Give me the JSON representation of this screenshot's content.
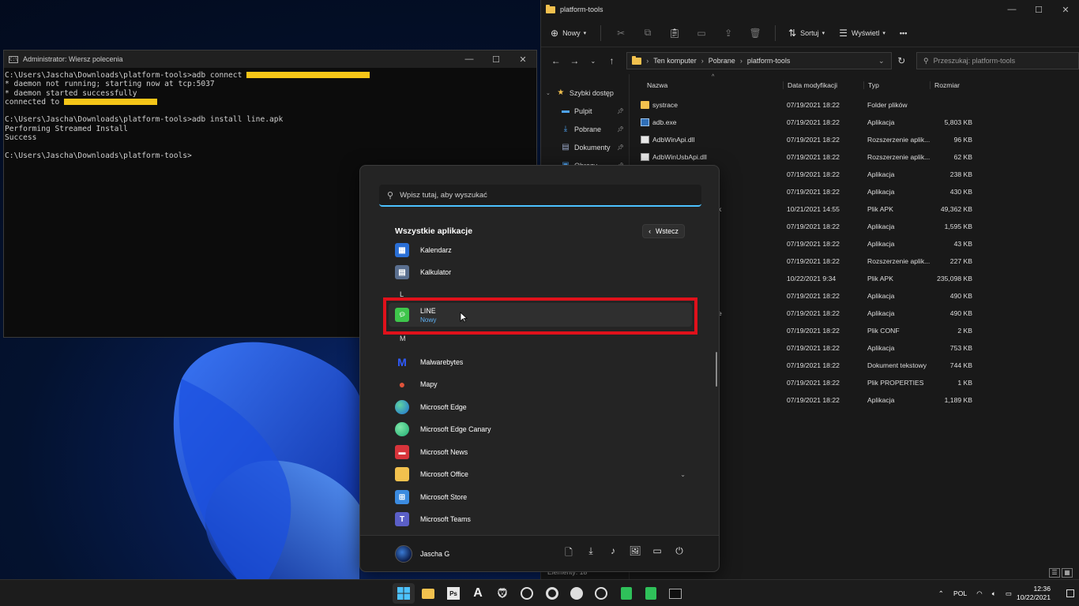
{
  "cmd": {
    "title": "Administrator: Wiersz polecenia",
    "lines": [
      "C:\\Users\\Jascha\\Downloads\\platform-tools>adb connect ",
      "* daemon not running; starting now at tcp:5037",
      "* daemon started successfully",
      "connected to ",
      "",
      "C:\\Users\\Jascha\\Downloads\\platform-tools>adb install line.apk",
      "Performing Streamed Install",
      "Success",
      "",
      "C:\\Users\\Jascha\\Downloads\\platform-tools>"
    ]
  },
  "explorer": {
    "title": "platform-tools",
    "toolbar": {
      "new_label": "Nowy",
      "sort_label": "Sortuj",
      "view_label": "Wyświetl",
      "more": "•••"
    },
    "breadcrumb": [
      "Ten komputer",
      "Pobrane",
      "platform-tools"
    ],
    "search_placeholder": "Przeszukaj: platform-tools",
    "nav": [
      {
        "label": "Szybki dostęp",
        "icon": "star-icon"
      },
      {
        "label": "Pulpit",
        "icon": "desktop-icon"
      },
      {
        "label": "Pobrane",
        "icon": "download-icon"
      },
      {
        "label": "Dokumenty",
        "icon": "document-icon"
      },
      {
        "label": "Obrazy",
        "icon": "picture-icon"
      }
    ],
    "columns": {
      "name": "Nazwa",
      "date": "Data modyfikacji",
      "type": "Typ",
      "size": "Rozmiar"
    },
    "files": [
      {
        "name": "systrace",
        "date": "07/19/2021 18:22",
        "type": "Folder plików",
        "size": "",
        "icon": "folder"
      },
      {
        "name": "adb.exe",
        "date": "07/19/2021 18:22",
        "type": "Aplikacja",
        "size": "5,803 KB",
        "icon": "exe"
      },
      {
        "name": "AdbWinApi.dll",
        "date": "07/19/2021 18:22",
        "type": "Rozszerzenie aplik...",
        "size": "96 KB",
        "icon": "dll"
      },
      {
        "name": "AdbWinUsbApi.dll",
        "date": "07/19/2021 18:22",
        "type": "Rozszerzenie aplik...",
        "size": "62 KB",
        "icon": "dll"
      },
      {
        "name": "",
        "date": "07/19/2021 18:22",
        "type": "Aplikacja",
        "size": "238 KB",
        "icon": ""
      },
      {
        "name": "",
        "date": "07/19/2021 18:22",
        "type": "Aplikacja",
        "size": "430 KB",
        "icon": ""
      },
      {
        "name": "k",
        "date": "10/21/2021 14:55",
        "type": "Plik APK",
        "size": "49,362 KB",
        "icon": ""
      },
      {
        "name": "",
        "date": "07/19/2021 18:22",
        "type": "Aplikacja",
        "size": "1,595 KB",
        "icon": ""
      },
      {
        "name": "",
        "date": "07/19/2021 18:22",
        "type": "Aplikacja",
        "size": "43 KB",
        "icon": ""
      },
      {
        "name": "",
        "date": "07/19/2021 18:22",
        "type": "Rozszerzenie aplik...",
        "size": "227 KB",
        "icon": ""
      },
      {
        "name": "",
        "date": "10/22/2021 9:34",
        "type": "Plik APK",
        "size": "235,098 KB",
        "icon": ""
      },
      {
        "name": "",
        "date": "07/19/2021 18:22",
        "type": "Aplikacja",
        "size": "490 KB",
        "icon": ""
      },
      {
        "name": "e",
        "date": "07/19/2021 18:22",
        "type": "Aplikacja",
        "size": "490 KB",
        "icon": ""
      },
      {
        "name": "",
        "date": "07/19/2021 18:22",
        "type": "Plik CONF",
        "size": "2 KB",
        "icon": ""
      },
      {
        "name": "",
        "date": "07/19/2021 18:22",
        "type": "Aplikacja",
        "size": "753 KB",
        "icon": ""
      },
      {
        "name": "",
        "date": "07/19/2021 18:22",
        "type": "Dokument tekstowy",
        "size": "744 KB",
        "icon": ""
      },
      {
        "name": "",
        "date": "07/19/2021 18:22",
        "type": "Plik PROPERTIES",
        "size": "1 KB",
        "icon": ""
      },
      {
        "name": "",
        "date": "07/19/2021 18:22",
        "type": "Aplikacja",
        "size": "1,189 KB",
        "icon": ""
      }
    ],
    "status": "Elementy: 18"
  },
  "start": {
    "search_placeholder": "Wpisz tutaj, aby wyszukać",
    "all_apps_title": "Wszystkie aplikacje",
    "back_label": "Wstecz",
    "letters": {
      "l": "L",
      "m": "M"
    },
    "apps": [
      {
        "name": "Kalendarz",
        "icon": "calendar-icon",
        "color": "#2a6fd6"
      },
      {
        "name": "Kalkulator",
        "icon": "calculator-icon",
        "color": "#5a6f8f"
      },
      {
        "name": "LINE",
        "sub": "Nowy",
        "icon": "line-icon",
        "color": "#3ec64b"
      },
      {
        "name": "Malwarebytes",
        "icon": "malwarebytes-icon",
        "color": "#2f5bff"
      },
      {
        "name": "Mapy",
        "icon": "map-pin-icon",
        "color": "#e0533a"
      },
      {
        "name": "Microsoft Edge",
        "icon": "edge-icon",
        "color": "#1e9ad6"
      },
      {
        "name": "Microsoft Edge Canary",
        "icon": "edge-canary-icon",
        "color": "#1fae73"
      },
      {
        "name": "Microsoft News",
        "icon": "news-icon",
        "color": "#d8343b"
      },
      {
        "name": "Microsoft Office",
        "icon": "folder-icon",
        "color": "#f2c14e"
      },
      {
        "name": "Microsoft Store",
        "icon": "store-icon",
        "color": "#3b8be0"
      },
      {
        "name": "Microsoft Teams",
        "icon": "teams-icon",
        "color": "#5b5fc7"
      }
    ],
    "user_name": "Jascha G"
  },
  "taskbar": {
    "lang": "POL",
    "time": "12:36",
    "date": "10/22/2021"
  }
}
